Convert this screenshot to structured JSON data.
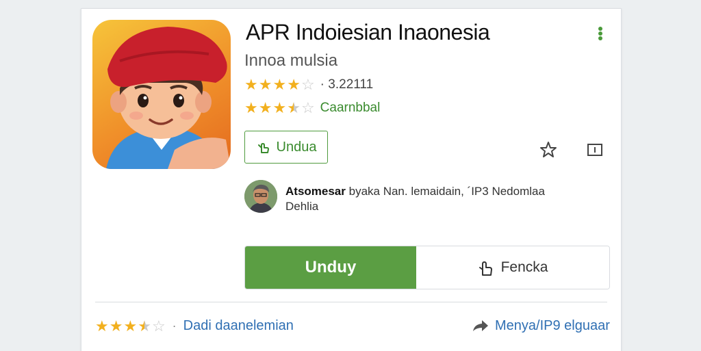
{
  "app": {
    "title": "APR Indoiesian Inaonesia",
    "developer": "Innoa mulsia",
    "rating_value": "3.22111",
    "category": "Caarnbbal"
  },
  "actions": {
    "outline_button_label": "Undua",
    "install_label": "Unduy",
    "secondary_label": "Fencka"
  },
  "author": {
    "name": "Atsomesar",
    "text": "byaka Nan. lemaidain, ´IP3 Nedomlaa",
    "text2": "Dehlia"
  },
  "footer": {
    "link": "Dadi daanelemian",
    "share_label": "Menya/IP9 elguaar"
  },
  "ratings": {
    "header_stars": 4.0,
    "category_stars": 3.5,
    "footer_stars": 3.5
  },
  "colors": {
    "accent_green": "#5b9e43",
    "link_blue": "#2f6fb3",
    "star_gold": "#f2b01e"
  },
  "icons": {
    "app_icon": "cartoon-boy-red-cap",
    "more": "vertical-dots-icon",
    "wishlist": "star-outline-icon",
    "screen": "screen-icon",
    "hand": "hand-pointer-icon",
    "share": "share-arrow-icon"
  }
}
